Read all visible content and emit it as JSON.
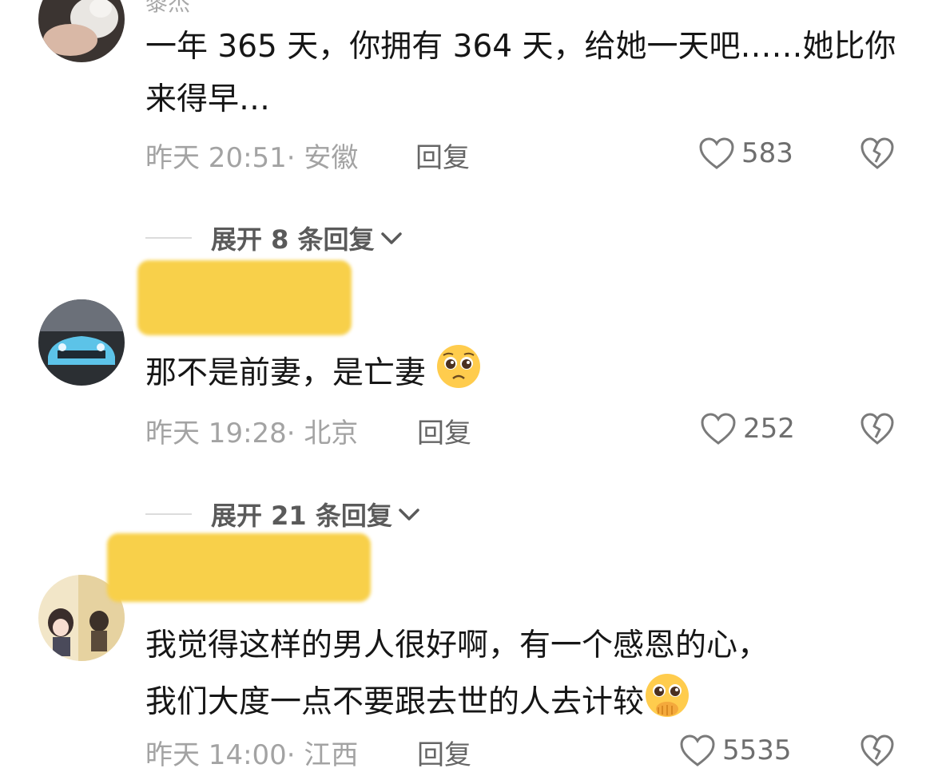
{
  "colors": {
    "background": "#ffffff",
    "text": "#161616",
    "meta_text": "#a3a3a3",
    "reply_text": "#666666",
    "redaction": "#f8d04a"
  },
  "icons": [
    "heart-outline-icon",
    "broken-heart-icon",
    "chevron-down-icon",
    "pleading-face-emoji",
    "hand-over-mouth-emoji"
  ],
  "comments": [
    {
      "username": "黎杰",
      "text": "一年 365 天，你拥有 364 天，给她一天吧……她比你来得早…",
      "time_location": "昨天 20:51· 安徽",
      "reply_label": "回复",
      "likes": "583"
    },
    {
      "username": "",
      "text": "那不是前妻，是亡妻",
      "time_location": "昨天 19:28· 北京",
      "reply_label": "回复",
      "likes": "252"
    },
    {
      "username": "",
      "text_line1": "我觉得这样的男人很好啊，有一个感恩的心，",
      "text_line2": "我们大度一点不要跟去世的人去计较",
      "time_location": "昨天 14:00· 江西",
      "reply_label": "回复",
      "likes": "5535"
    }
  ],
  "expand_replies": [
    {
      "label": "展开 8 条回复"
    },
    {
      "label": "展开 21 条回复"
    }
  ]
}
